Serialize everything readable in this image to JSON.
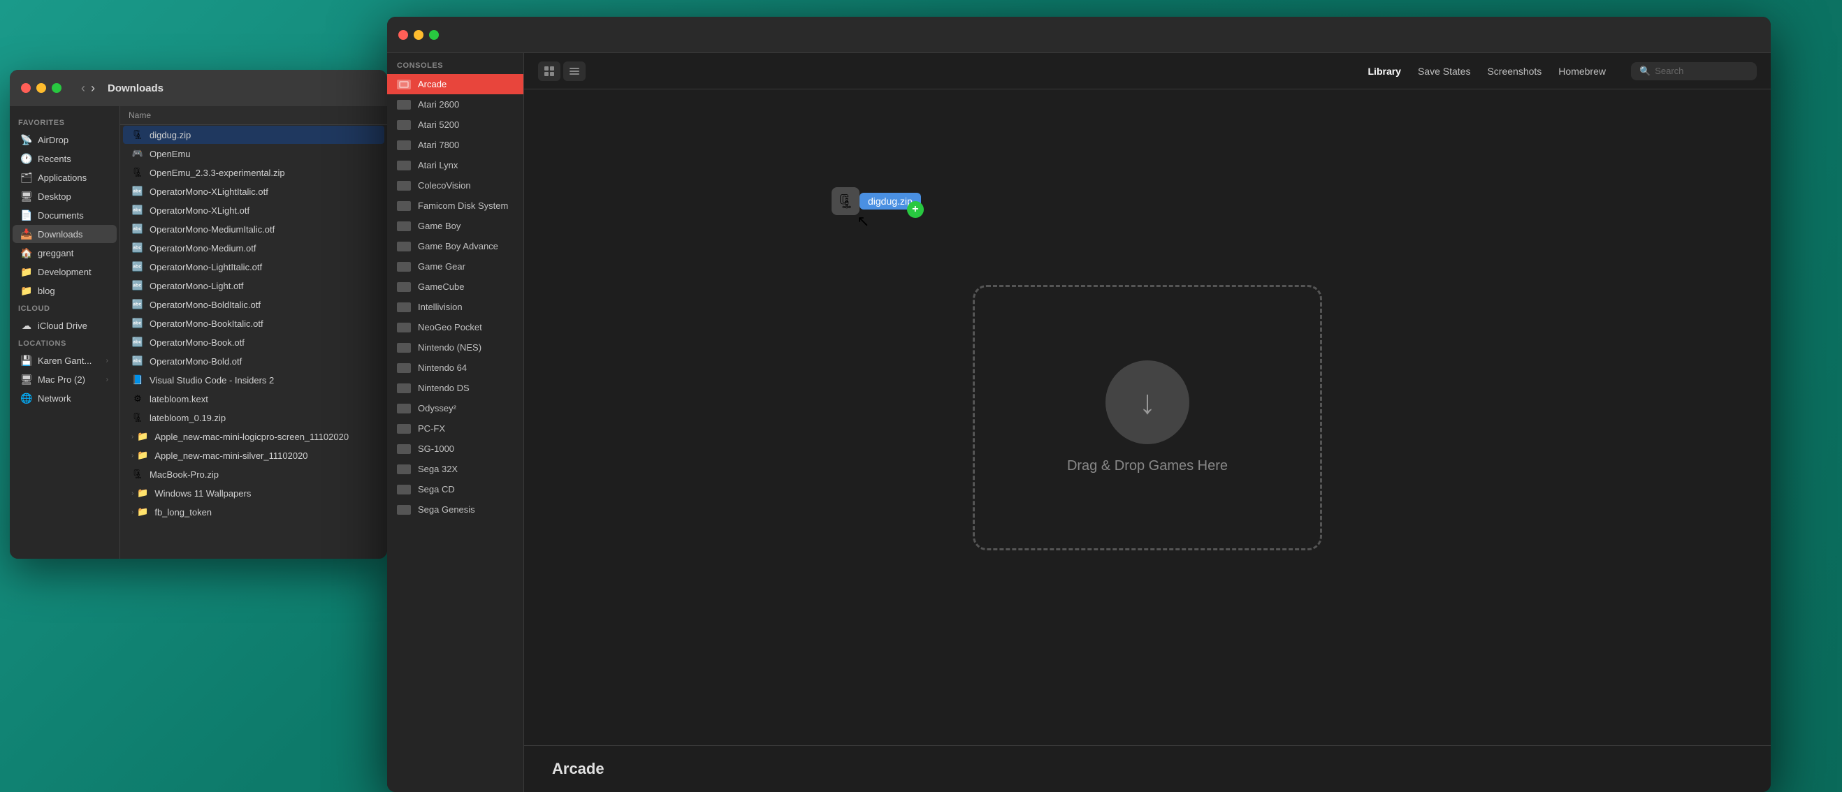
{
  "finder": {
    "title": "Downloads",
    "traffic_lights": [
      "close",
      "minimize",
      "maximize"
    ],
    "sidebar": {
      "sections": [
        {
          "label": "Favorites",
          "items": [
            {
              "id": "airdrop",
              "icon": "📡",
              "label": "AirDrop"
            },
            {
              "id": "recents",
              "icon": "🕐",
              "label": "Recents"
            },
            {
              "id": "applications",
              "icon": "🗂",
              "label": "Applications"
            },
            {
              "id": "desktop",
              "icon": "🖥",
              "label": "Desktop"
            },
            {
              "id": "documents",
              "icon": "📄",
              "label": "Documents"
            },
            {
              "id": "downloads",
              "icon": "📥",
              "label": "Downloads",
              "active": true
            },
            {
              "id": "greggant",
              "icon": "🏠",
              "label": "greggant"
            },
            {
              "id": "development",
              "icon": "📁",
              "label": "Development"
            },
            {
              "id": "blog",
              "icon": "📁",
              "label": "blog"
            }
          ]
        },
        {
          "label": "iCloud",
          "items": [
            {
              "id": "icloud-drive",
              "icon": "☁",
              "label": "iCloud Drive"
            }
          ]
        },
        {
          "label": "Locations",
          "items": [
            {
              "id": "karen-gant",
              "icon": "💾",
              "label": "Karen Gant...",
              "expandable": true
            },
            {
              "id": "mac-pro",
              "icon": "🖥",
              "label": "Mac Pro (2)",
              "expandable": true
            },
            {
              "id": "network",
              "icon": "🌐",
              "label": "Network"
            }
          ]
        }
      ]
    },
    "files": {
      "header": "Name",
      "items": [
        {
          "id": "digdug",
          "icon": "🗜",
          "name": "digdug.zip",
          "selected": true
        },
        {
          "id": "openemu",
          "icon": "🎮",
          "name": "OpenEmu"
        },
        {
          "id": "openemu-zip",
          "icon": "🗜",
          "name": "OpenEmu_2.3.3-experimental.zip"
        },
        {
          "id": "op-mono-xlightitalic",
          "icon": "🔤",
          "name": "OperatorMono-XLightItalic.otf"
        },
        {
          "id": "op-mono-xlight",
          "icon": "🔤",
          "name": "OperatorMono-XLight.otf"
        },
        {
          "id": "op-mono-meditalic",
          "icon": "🔤",
          "name": "OperatorMono-MediumItalic.otf"
        },
        {
          "id": "op-mono-medium",
          "icon": "🔤",
          "name": "OperatorMono-Medium.otf"
        },
        {
          "id": "op-mono-lightitalic",
          "icon": "🔤",
          "name": "OperatorMono-LightItalic.otf"
        },
        {
          "id": "op-mono-light",
          "icon": "🔤",
          "name": "OperatorMono-Light.otf"
        },
        {
          "id": "op-mono-bolditalic",
          "icon": "🔤",
          "name": "OperatorMono-BoldItalic.otf"
        },
        {
          "id": "op-mono-bookitalic",
          "icon": "🔤",
          "name": "OperatorMono-BookItalic.otf"
        },
        {
          "id": "op-mono-book",
          "icon": "🔤",
          "name": "OperatorMono-Book.otf"
        },
        {
          "id": "op-mono-bold",
          "icon": "🔤",
          "name": "OperatorMono-Bold.otf"
        },
        {
          "id": "vscode",
          "icon": "📘",
          "name": "Visual Studio Code - Insiders 2"
        },
        {
          "id": "latebloom-kext",
          "icon": "⚙",
          "name": "latebloom.kext"
        },
        {
          "id": "latebloom-zip",
          "icon": "🗜",
          "name": "latebloom_0.19.zip"
        },
        {
          "id": "apple-logicpro",
          "icon": "📁",
          "name": "Apple_new-mac-mini-logicpro-screen_11102020",
          "expandable": true
        },
        {
          "id": "apple-silver",
          "icon": "📁",
          "name": "Apple_new-mac-mini-silver_11102020",
          "expandable": true
        },
        {
          "id": "macbook-zip",
          "icon": "🗜",
          "name": "MacBook-Pro.zip"
        },
        {
          "id": "windows-wallpapers",
          "icon": "📁",
          "name": "Windows 11 Wallpapers",
          "expandable": true
        },
        {
          "id": "fb-long",
          "icon": "📁",
          "name": "fb_long_token",
          "expandable": true
        }
      ]
    }
  },
  "openemu": {
    "toolbar": {
      "view_grid_label": "⊞",
      "view_list_label": "≡",
      "nav_items": [
        {
          "id": "library",
          "label": "Library",
          "active": true
        },
        {
          "id": "save-states",
          "label": "Save States"
        },
        {
          "id": "screenshots",
          "label": "Screenshots"
        },
        {
          "id": "homebrew",
          "label": "Homebrew"
        }
      ],
      "search_placeholder": "Search"
    },
    "console_sidebar": {
      "section_label": "Consoles",
      "items": [
        {
          "id": "arcade",
          "label": "Arcade",
          "active": true
        },
        {
          "id": "atari-2600",
          "label": "Atari 2600"
        },
        {
          "id": "atari-5200",
          "label": "Atari 5200"
        },
        {
          "id": "atari-7800",
          "label": "Atari 7800"
        },
        {
          "id": "atari-lynx",
          "label": "Atari Lynx"
        },
        {
          "id": "colecovision",
          "label": "ColecoVision"
        },
        {
          "id": "famicom-disk",
          "label": "Famicom Disk System"
        },
        {
          "id": "game-boy",
          "label": "Game Boy"
        },
        {
          "id": "game-boy-advance",
          "label": "Game Boy Advance"
        },
        {
          "id": "game-gear",
          "label": "Game Gear"
        },
        {
          "id": "gamecube",
          "label": "GameCube"
        },
        {
          "id": "intellivision",
          "label": "Intellivision"
        },
        {
          "id": "neogeo-pocket",
          "label": "NeoGeo Pocket"
        },
        {
          "id": "nintendo-nes",
          "label": "Nintendo (NES)"
        },
        {
          "id": "nintendo-64",
          "label": "Nintendo 64"
        },
        {
          "id": "nintendo-ds",
          "label": "Nintendo DS"
        },
        {
          "id": "odyssey2",
          "label": "Odyssey²"
        },
        {
          "id": "pc-fx",
          "label": "PC-FX"
        },
        {
          "id": "sg-1000",
          "label": "SG-1000"
        },
        {
          "id": "sega-32x",
          "label": "Sega 32X"
        },
        {
          "id": "sega-cd",
          "label": "Sega CD"
        },
        {
          "id": "sega-genesis",
          "label": "Sega Genesis"
        }
      ]
    },
    "drop_zone": {
      "text": "Drag & Drop Games Here"
    },
    "drag_file": {
      "label": "digdug.zip"
    },
    "bottom": {
      "section_title": "Arcade"
    }
  }
}
